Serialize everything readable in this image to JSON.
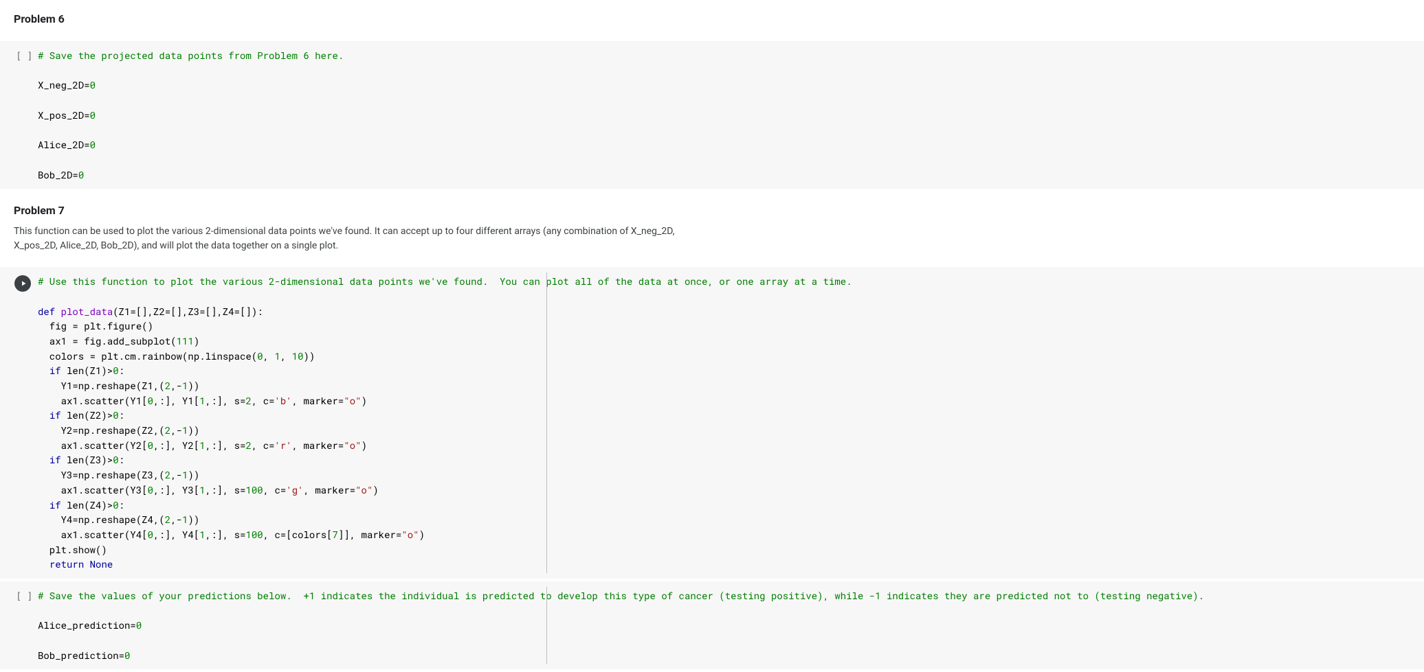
{
  "cells": {
    "heading6": "Problem 6",
    "code1_prompt": "[ ]",
    "code1_comment": "# Save the projected data points from Problem 6 here.",
    "code1_l1": "X_neg_2D=",
    "code1_l1_v": "0",
    "code1_l2": "X_pos_2D=",
    "code1_l2_v": "0",
    "code1_l3": "Alice_2D=",
    "code1_l3_v": "0",
    "code1_l4": "Bob_2D=",
    "code1_l4_v": "0",
    "heading7": "Problem 7",
    "desc7": "This function can be used to plot the various 2-dimensional data points we've found. It can accept up to four different arrays (any combination of X_neg_2D, X_pos_2D, Alice_2D, Bob_2D), and will plot the data together on a single plot.",
    "code2_comment": "# Use this function to plot the various 2-dimensional data points we've found.  You can plot all of the data at once, or one array at a time.",
    "code2": {
      "def": "def",
      "fname": "plot_data",
      "sig": "(Z1=[],Z2=[],Z3=[],Z4=[]):",
      "l1_a": "  fig = plt.figure()",
      "l2_a": "  ax1 = fig.add_subplot(",
      "l2_b": "111",
      "l2_c": ")",
      "l3_a": "  colors = plt.cm.rainbow(np.linspace(",
      "l3_b": "0",
      "l3_c": ", ",
      "l3_d": "1",
      "l3_e": ", ",
      "l3_f": "10",
      "l3_g": "))",
      "if": "if",
      "lenZ1": " len(Z1)>",
      "lenZ2": " len(Z2)>",
      "lenZ3": " len(Z3)>",
      "lenZ4": " len(Z4)>",
      "zero": "0",
      "colon": ":",
      "r1a": "    Y1=np.reshape(Z1,(",
      "two": "2",
      "comma_minus1": ",-",
      "one": "1",
      "close2": "))",
      "s1a": "    ax1.scatter(Y1[",
      "idx0": "0",
      "slice": ",:], Y1[",
      "idx1": "1",
      "after": ",:], s=",
      "sval2": "2",
      "sval100": "100",
      "cpre": ", c=",
      "cb": "'b'",
      "cr": "'r'",
      "cg": "'g'",
      "colors7": "[colors[",
      "seven": "7",
      "colors7b": "]]",
      "mpre": ", marker=",
      "mo": "\"o\"",
      "close1": ")",
      "r2a": "    Y2=np.reshape(Z2,(",
      "s2a": "    ax1.scatter(Y2[",
      "s2b": ",:], Y2[",
      "r3a": "    Y3=np.reshape(Z3,(",
      "s3a": "    ax1.scatter(Y3[",
      "s3b": ",:], Y3[",
      "r4a": "    Y4=np.reshape(Z4,(",
      "s4a": "    ax1.scatter(Y4[",
      "s4b": ",:], Y4[",
      "show": "  plt.show()",
      "return": "return",
      "retsp": "  ",
      "none": "None"
    },
    "code3_prompt": "[ ]",
    "code3_comment": "# Save the values of your predictions below.  +1 indicates the individual is predicted to develop this type of cancer (testing positive), while -1 indicates they are predicted not to (testing negative).",
    "code3_l1": "Alice_prediction=",
    "code3_l1_v": "0",
    "code3_l2": "Bob_prediction=",
    "code3_l2_v": "0"
  }
}
